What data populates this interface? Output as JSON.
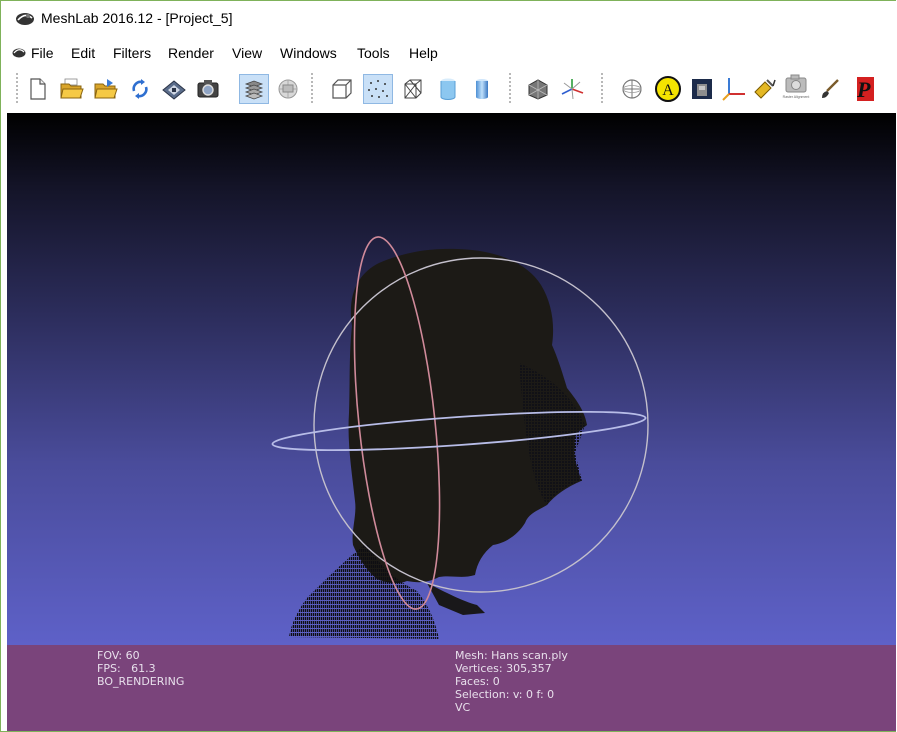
{
  "window": {
    "title": "MeshLab 2016.12 - [Project_5]",
    "app_icon": "meshlab-logo-icon"
  },
  "menu": {
    "items": [
      "File",
      "Edit",
      "Filters",
      "Render",
      "View",
      "Windows",
      "Tools",
      "Help"
    ]
  },
  "toolbar": {
    "buttons": [
      {
        "icon": "new-document-icon",
        "active": false
      },
      {
        "icon": "open-project-icon",
        "active": false
      },
      {
        "icon": "import-mesh-icon",
        "active": false
      },
      {
        "icon": "reload-icon",
        "active": false
      },
      {
        "icon": "export-mesh-icon",
        "active": false
      },
      {
        "icon": "snapshot-icon",
        "active": false
      },
      {
        "icon": "show-layers-icon",
        "active": true
      },
      {
        "icon": "raster-layers-icon",
        "active": false
      },
      {
        "icon": "bounding-box-icon",
        "active": false
      },
      {
        "icon": "points-render-icon",
        "active": true
      },
      {
        "icon": "wireframe-render-icon",
        "active": false
      },
      {
        "icon": "flat-shading-icon",
        "active": false
      },
      {
        "icon": "smooth-shading-icon",
        "active": false
      },
      {
        "icon": "mesh-layer-icon",
        "active": false
      },
      {
        "icon": "axes-transform-icon",
        "active": false
      },
      {
        "icon": "trackball-icon",
        "active": false
      },
      {
        "icon": "annotation-a-icon",
        "active": false
      },
      {
        "icon": "texture-icon",
        "active": false
      },
      {
        "icon": "coordinate-axes-icon",
        "active": false
      },
      {
        "icon": "paint-roller-icon",
        "active": false
      },
      {
        "icon": "raster-alignment-icon",
        "active": false
      },
      {
        "icon": "paint-brush-icon",
        "active": false
      },
      {
        "icon": "pdf-export-icon",
        "active": false
      }
    ],
    "raster_alignment_caption": "Raster Alignment"
  },
  "viewport": {
    "background_top": "#000000",
    "background_bottom": "#5e61c8",
    "trackball_colors": {
      "vertical": "#d08a9a",
      "horizontal": "#b8bde8",
      "outer": "#c4c0cc"
    }
  },
  "info": {
    "fov": "FOV: 60",
    "fps": "FPS:   61.3",
    "render_mode": "BO_RENDERING",
    "mesh": "Mesh: Hans scan.ply",
    "vertices": "Vertices: 305,357",
    "faces": "Faces: 0",
    "selection": "Selection: v: 0 f: 0",
    "vc": "VC"
  },
  "colors": {
    "accent_border": "#7fb25a",
    "info_panel": "#7a447b",
    "active_button": "#c9e0f7"
  }
}
